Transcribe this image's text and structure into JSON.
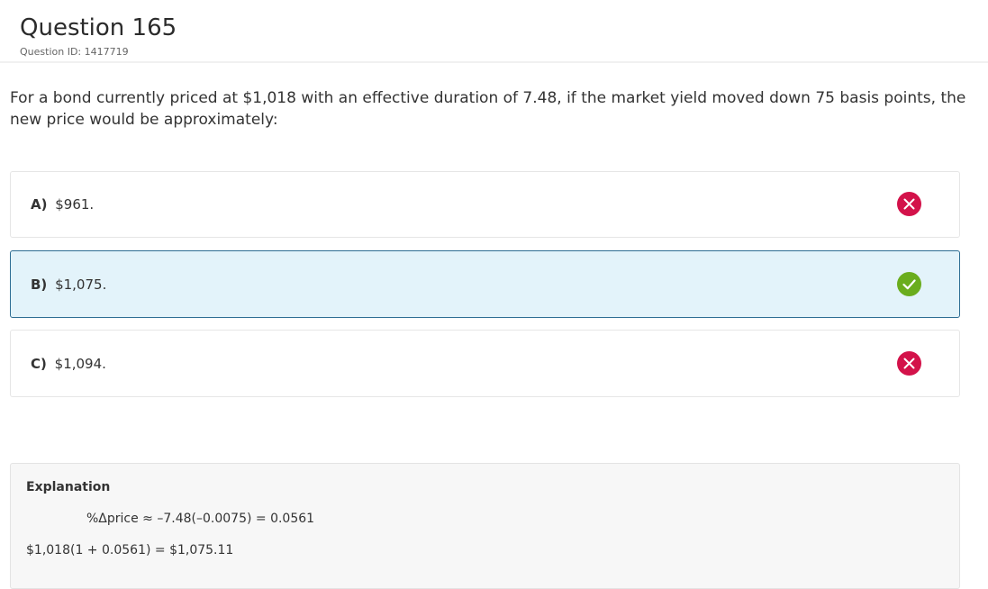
{
  "header": {
    "title": "Question 165",
    "question_id": "Question ID: 1417719"
  },
  "stem": "For a bond currently priced at $1,018 with an effective duration of 7.48, if the market yield moved down 75 basis points, the new price would be approximately:",
  "options": [
    {
      "letter": "A)",
      "text": "$961.",
      "status": "incorrect",
      "icon": "x-icon"
    },
    {
      "letter": "B)",
      "text": "$1,075.",
      "status": "correct",
      "icon": "check-icon"
    },
    {
      "letter": "C)",
      "text": "$1,094.",
      "status": "incorrect",
      "icon": "x-icon"
    }
  ],
  "explanation": {
    "heading": "Explanation",
    "line1": "%Δprice ≈ –7.48(–0.0075) = 0.0561",
    "line2": "$1,018(1 + 0.0561) = $1,075.11"
  },
  "colors": {
    "correct_bg": "#e3f3fa",
    "correct_border": "#2d6d93",
    "wrong_icon": "#d3124a",
    "right_icon": "#6aad1d"
  }
}
